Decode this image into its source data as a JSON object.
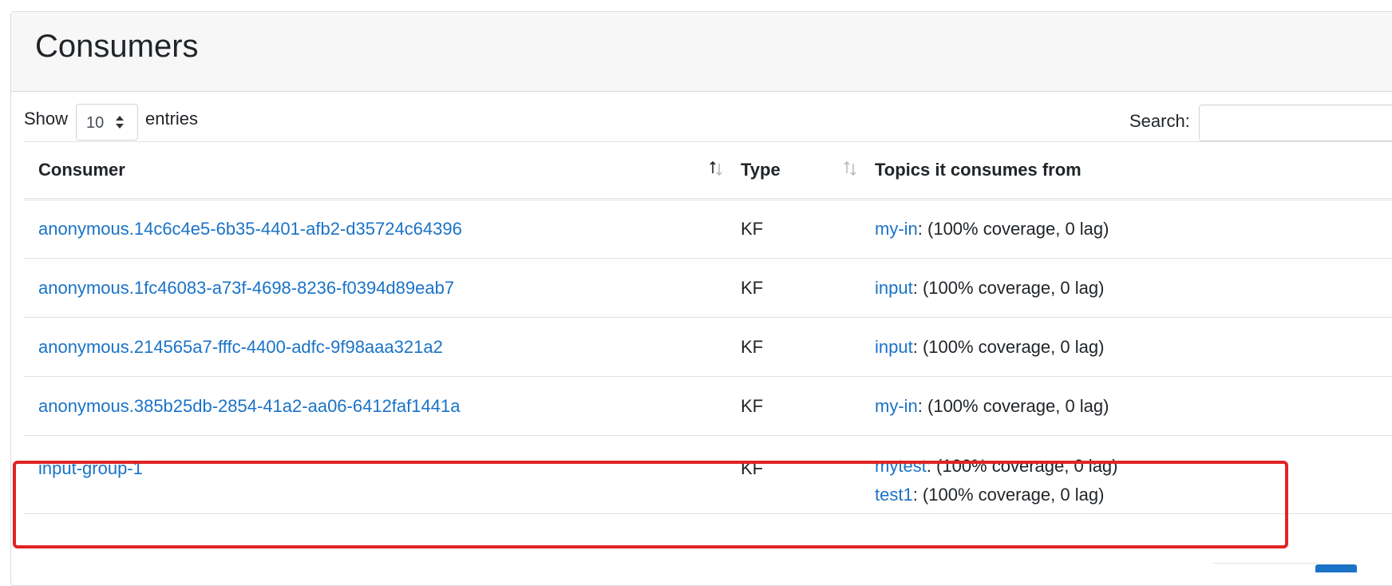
{
  "header": {
    "title": "Consumers"
  },
  "controls": {
    "show_label": "Show",
    "entries_value": "10",
    "entries_label": "entries",
    "search_label": "Search:",
    "search_value": ""
  },
  "table": {
    "columns": [
      "Consumer",
      "Type",
      "Topics it consumes from"
    ],
    "rows": [
      {
        "consumer": "anonymous.14c6c4e5-6b35-4401-afb2-d35724c64396",
        "type": "KF",
        "topics": [
          {
            "name": "my-in",
            "info": ": (100% coverage, 0 lag)"
          }
        ]
      },
      {
        "consumer": "anonymous.1fc46083-a73f-4698-8236-f0394d89eab7",
        "type": "KF",
        "topics": [
          {
            "name": "input",
            "info": ": (100% coverage, 0 lag)"
          }
        ]
      },
      {
        "consumer": "anonymous.214565a7-fffc-4400-adfc-9f98aaa321a2",
        "type": "KF",
        "topics": [
          {
            "name": "input",
            "info": ": (100% coverage, 0 lag)"
          }
        ]
      },
      {
        "consumer": "anonymous.385b25db-2854-41a2-aa06-6412faf1441a",
        "type": "KF",
        "topics": [
          {
            "name": "my-in",
            "info": ": (100% coverage, 0 lag)"
          }
        ]
      },
      {
        "consumer": "input-group-1",
        "type": "KF",
        "topics": [
          {
            "name": "mytest",
            "info": ": (100% coverage, 0 lag)"
          },
          {
            "name": "test1",
            "info": ": (100% coverage, 0 lag)"
          }
        ]
      }
    ]
  },
  "colors": {
    "link": "#1a73c7",
    "highlight": "#e02424"
  }
}
